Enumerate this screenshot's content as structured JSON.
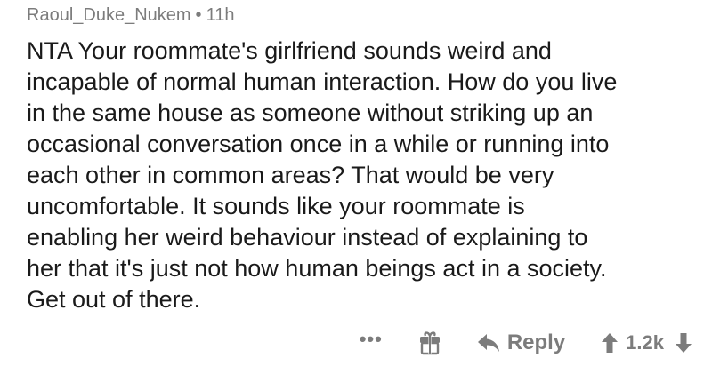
{
  "comment": {
    "author": "Raoul_Duke_Nukem",
    "separator": "•",
    "age": "11h",
    "body": "NTA Your roommate's girlfriend sounds weird and\nincapable of normal human interaction. How do you live\nin the same house as someone without striking up an\noccasional conversation once in a while or running into\neach other in common areas? That would be very\nuncomfortable. It sounds like your roommate is\nenabling her weird behaviour instead of explaining to\nher that it's just not how human beings act in a society.\nGet out of there.",
    "actions": {
      "more_label": "•••",
      "more_icon": "more-dots-icon",
      "award_icon": "gift-icon",
      "reply_icon": "reply-arrow-icon",
      "reply_label": "Reply",
      "upvote_icon": "upvote-arrow-icon",
      "score": "1.2k",
      "downvote_icon": "downvote-arrow-icon"
    },
    "colors": {
      "text": "#1a1a1a",
      "meta": "#7c7c7c",
      "background": "#ffffff"
    }
  }
}
